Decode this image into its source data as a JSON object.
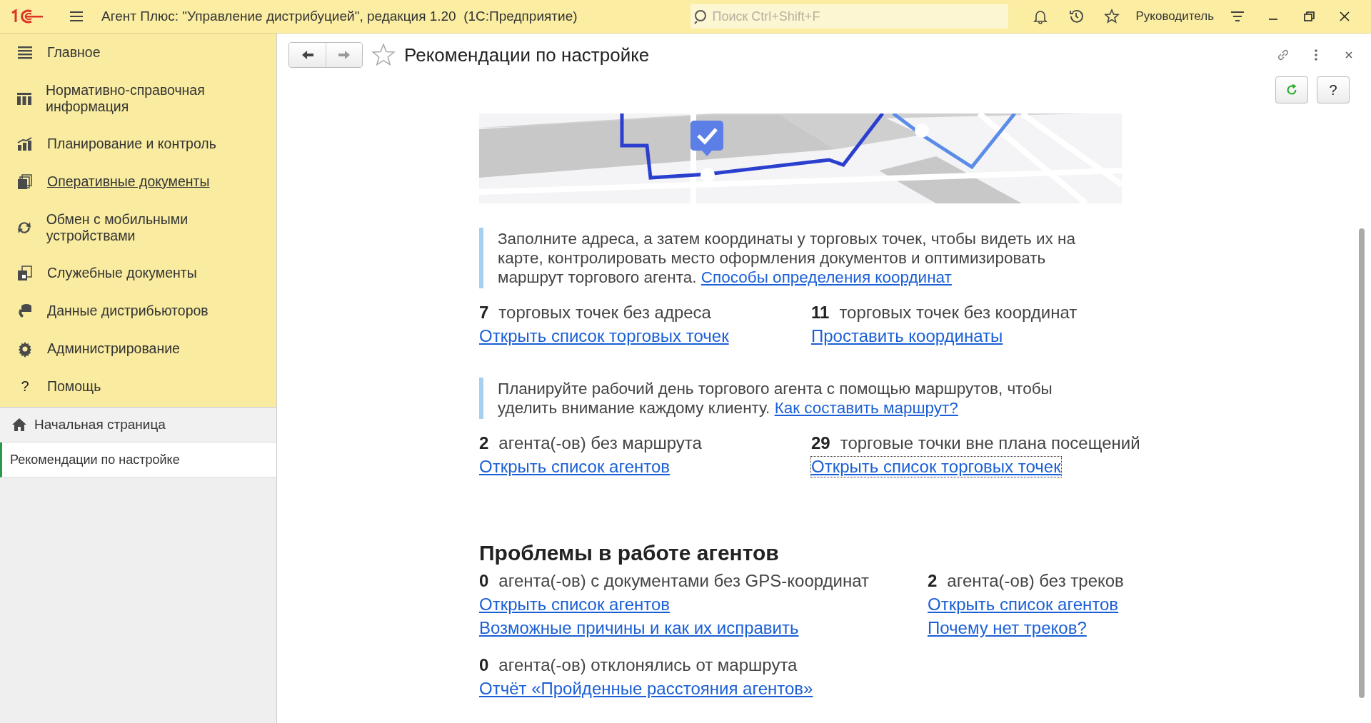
{
  "top_bar": {
    "title": "Агент Плюс: \"Управление дистрибуцией\", редакция 1.20  (1С:Предприятие)",
    "search": {
      "placeholder": "Поиск Ctrl+Shift+F"
    },
    "user": "Руководитель"
  },
  "sidebar": {
    "help_glyph": "?",
    "items": [
      {
        "label": "Главное",
        "hovered": false
      },
      {
        "label": "Нормативно-справочная информация",
        "hovered": false
      },
      {
        "label": "Планирование и контроль",
        "hovered": false
      },
      {
        "label": "Оперативные документы",
        "hovered": true
      },
      {
        "label": "Обмен с мобильными устройствами",
        "hovered": false
      },
      {
        "label": "Служебные документы",
        "hovered": false
      },
      {
        "label": "Данные дистрибьюторов",
        "hovered": false
      },
      {
        "label": "Администрирование",
        "hovered": false
      },
      {
        "label": "Помощь",
        "hovered": false
      }
    ],
    "open_pages": [
      {
        "label": "Начальная страница",
        "selected": false
      },
      {
        "label": "Рекомендации по настройке",
        "selected": true
      }
    ]
  },
  "page": {
    "title": "Рекомендации по настройке",
    "help_button": "?",
    "hint_1": {
      "text": "Заполните адреса, а затем координаты у торговых точек, чтобы видеть их на карте, контролировать место оформления документов и оптимизировать маршрут торгового агента.",
      "link": "Способы определения координат"
    },
    "stats_1": [
      {
        "count": "7",
        "label": "торговых точек без адреса",
        "links": [
          {
            "text": "Открыть список торговых точек",
            "focused": false
          }
        ]
      },
      {
        "count": "11",
        "label": "торговых точек без координат",
        "links": [
          {
            "text": "Проставить координаты",
            "focused": false
          }
        ]
      }
    ],
    "hint_2": {
      "text": "Планируйте рабочий день торгового агента с помощью маршрутов, чтобы уделить внимание каждому клиенту.",
      "link": "Как составить маршрут?"
    },
    "stats_2": [
      {
        "count": "2",
        "label": "агента(-ов) без маршрута",
        "links": [
          {
            "text": "Открыть список агентов",
            "focused": false
          }
        ]
      },
      {
        "count": "29",
        "label": "торговые точки вне плана посещений",
        "links": [
          {
            "text": "Открыть список торговых точек",
            "focused": true
          }
        ]
      }
    ],
    "problems": {
      "heading": "Проблемы в работе агентов",
      "items": [
        {
          "count": "0",
          "label": "агента(-ов) с документами без GPS-координат",
          "links": [
            {
              "text": "Открыть список агентов",
              "focused": false
            },
            {
              "text": "Возможные причины и как их исправить",
              "focused": false
            }
          ]
        },
        {
          "count": "2",
          "label": "агента(-ов) без треков",
          "links": [
            {
              "text": "Открыть список агентов",
              "focused": false
            },
            {
              "text": "Почему нет треков?",
              "focused": false
            }
          ]
        },
        {
          "count": "0",
          "label": "агента(-ов) отклонялись от маршрута",
          "links": [
            {
              "text": "Отчёт «Пройденные расстояния агентов»",
              "focused": false
            }
          ]
        }
      ]
    }
  }
}
